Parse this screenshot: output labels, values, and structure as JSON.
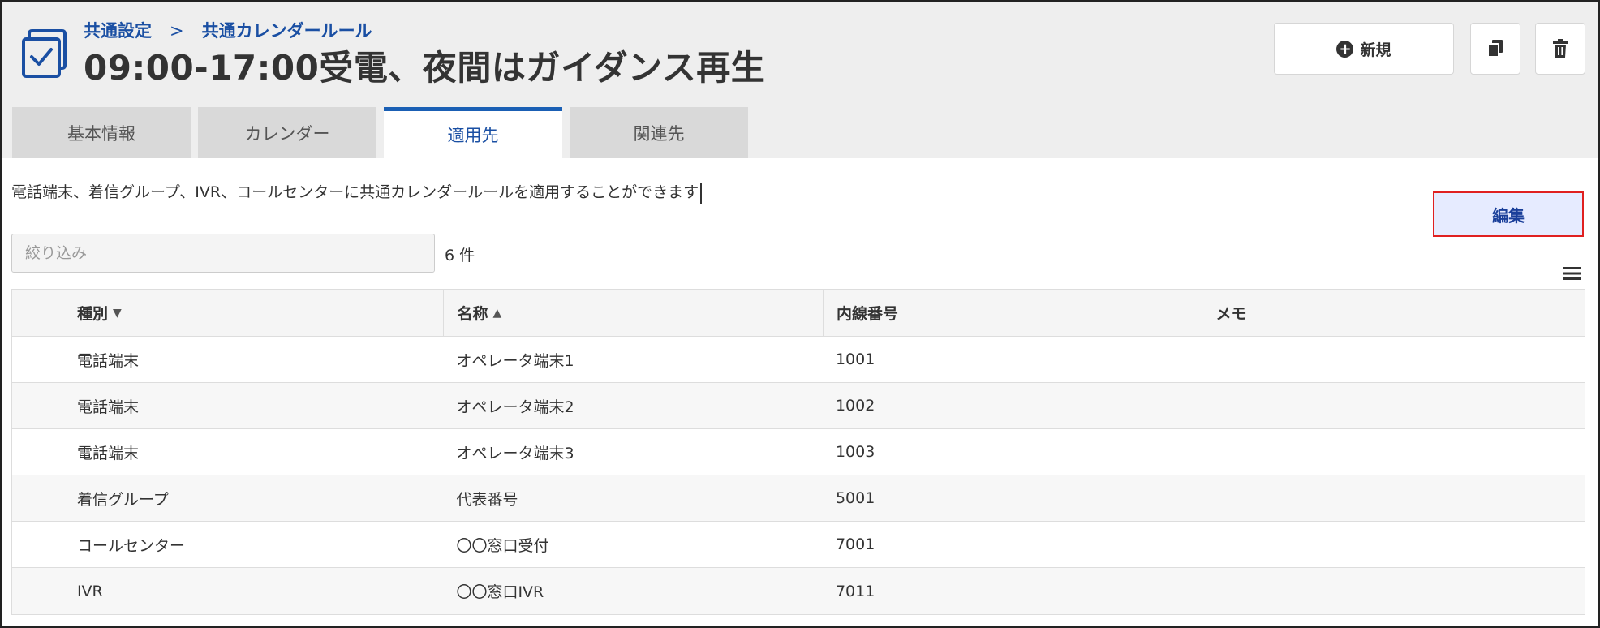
{
  "breadcrumb": {
    "parent": "共通設定",
    "separator": ">",
    "current": "共通カレンダールール"
  },
  "page_title": "09:00-17:00受電、夜間はガイダンス再生",
  "toolbar": {
    "new_label": "新規",
    "copy_icon": "copy-icon",
    "delete_icon": "trash-icon"
  },
  "tabs": [
    {
      "label": "基本情報",
      "active": false
    },
    {
      "label": "カレンダー",
      "active": false
    },
    {
      "label": "適用先",
      "active": true
    },
    {
      "label": "関連先",
      "active": false
    }
  ],
  "description": "電話端末、着信グループ、IVR、コールセンターに共通カレンダールールを適用することができます",
  "edit_label": "編集",
  "filter": {
    "placeholder": "絞り込み",
    "value": ""
  },
  "count": "6 件",
  "table": {
    "headers": [
      {
        "label": "種別",
        "sort": "▼"
      },
      {
        "label": "名称",
        "sort": "▲"
      },
      {
        "label": "内線番号",
        "sort": ""
      },
      {
        "label": "メモ",
        "sort": ""
      }
    ],
    "rows": [
      {
        "type": "電話端末",
        "name": "オペレータ端末1",
        "ext": "1001",
        "memo": ""
      },
      {
        "type": "電話端末",
        "name": "オペレータ端末2",
        "ext": "1002",
        "memo": ""
      },
      {
        "type": "電話端末",
        "name": "オペレータ端末3",
        "ext": "1003",
        "memo": ""
      },
      {
        "type": "着信グループ",
        "name": "代表番号",
        "ext": "5001",
        "memo": ""
      },
      {
        "type": "コールセンター",
        "name": "〇〇窓口受付",
        "ext": "7001",
        "memo": ""
      },
      {
        "type": "IVR",
        "name": "〇〇窓口IVR",
        "ext": "7011",
        "memo": ""
      }
    ]
  },
  "colors": {
    "accent": "#1a4fa3",
    "header_bg": "#eeeeee",
    "edit_highlight": "#e02020"
  }
}
